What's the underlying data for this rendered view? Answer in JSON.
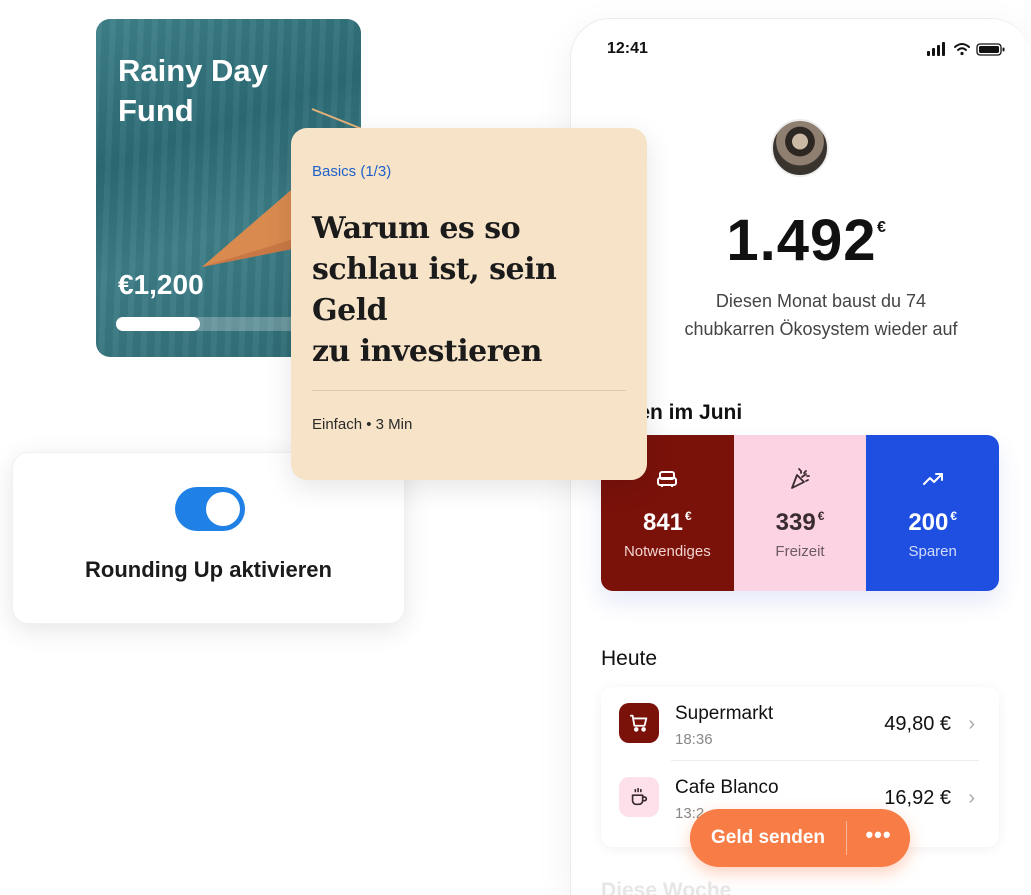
{
  "status_bar": {
    "time": "12:41",
    "icons": [
      "signal-icon",
      "wifi-icon",
      "battery-icon"
    ]
  },
  "overview": {
    "balance": "1.492",
    "currency": "€",
    "subtitle_line1": "Diesen Monat baust du 74",
    "subtitle_line2": "chubkarren Ökosystem wieder auf"
  },
  "spending": {
    "title": "gaben im Juni",
    "categories": [
      {
        "amount": "841",
        "currency": "€",
        "label": "Notwendiges",
        "icon": "sofa-icon",
        "color": "#7a120a"
      },
      {
        "amount": "339",
        "currency": "€",
        "label": "Freizeit",
        "icon": "party-popper-icon",
        "color": "#fbd3e2"
      },
      {
        "amount": "200",
        "currency": "€",
        "label": "Sparen",
        "icon": "trending-up-icon",
        "color": "#1f4fe0"
      }
    ]
  },
  "today": {
    "title": "Heute",
    "transactions": [
      {
        "name": "Supermarkt",
        "time": "18:36",
        "amount": "49,80 €",
        "icon": "shopping-cart-icon"
      },
      {
        "name": "Cafe Blanco",
        "time": "13:2",
        "amount": "16,92 €",
        "icon": "coffee-cup-icon"
      }
    ]
  },
  "week": {
    "title": "Diese Woche"
  },
  "actions": {
    "send_label": "Geld senden",
    "more_label": "•••"
  },
  "rainy_day": {
    "title_line1": "Rainy Day",
    "title_line2": "Fund",
    "amount": "€1,200",
    "progress": 0.35
  },
  "basics": {
    "tag": "Basics (1/3)",
    "title_line1": "Warum es so",
    "title_line2": "schlau ist, sein Geld",
    "title_line3": "zu investieren",
    "meta": "Einfach • 3 Min"
  },
  "rounding": {
    "label": "Rounding Up aktivieren",
    "enabled": true
  },
  "colors": {
    "accent_orange": "#f87c45",
    "toggle_blue": "#1f80e5",
    "link_blue": "#1f62c9",
    "card_beige": "#f6e3c8"
  }
}
